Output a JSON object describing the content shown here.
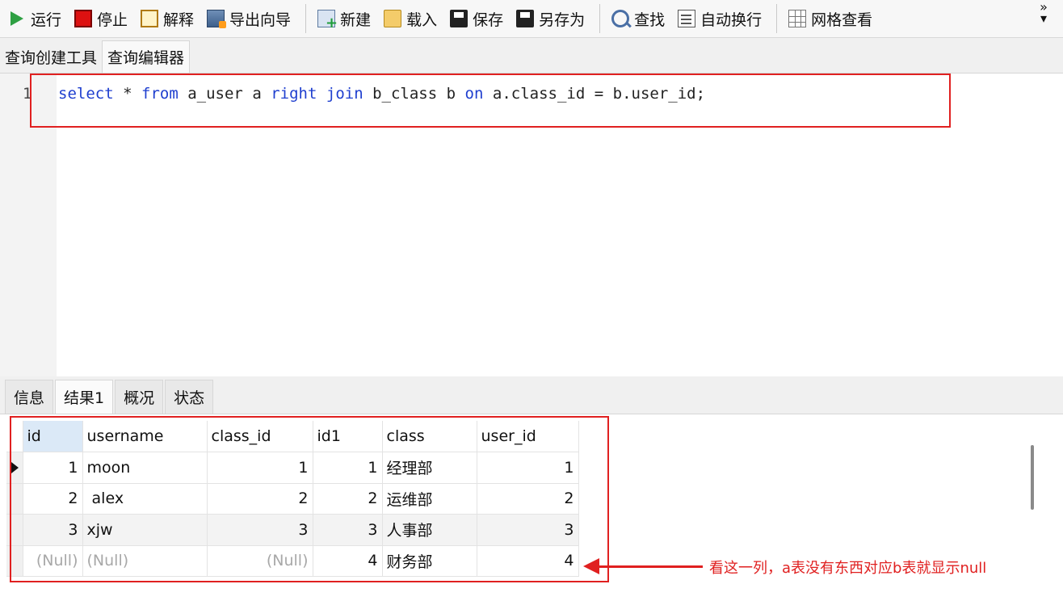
{
  "toolbar": {
    "buttons": [
      {
        "label": "运行",
        "icon": "run-icon"
      },
      {
        "label": "停止",
        "icon": "stop-icon"
      },
      {
        "label": "解释",
        "icon": "explain-icon"
      },
      {
        "label": "导出向导",
        "icon": "export-icon"
      },
      {
        "label": "新建",
        "icon": "new-icon"
      },
      {
        "label": "载入",
        "icon": "load-icon"
      },
      {
        "label": "保存",
        "icon": "save-icon"
      },
      {
        "label": "另存为",
        "icon": "save-as-icon"
      },
      {
        "label": "查找",
        "icon": "search-icon"
      },
      {
        "label": "自动换行",
        "icon": "word-wrap-icon"
      },
      {
        "label": "网格查看",
        "icon": "grid-view-icon"
      }
    ],
    "overflow": "»\n▾"
  },
  "editor_tabs": [
    "查询创建工具",
    "查询编辑器"
  ],
  "editor": {
    "line_number": "1",
    "sql": "select * from a_user a right join b_class b on a.class_id = b.user_id;"
  },
  "result_tabs": [
    "信息",
    "结果1",
    "概况",
    "状态"
  ],
  "grid": {
    "columns": [
      "id",
      "username",
      "class_id",
      "id1",
      "class",
      "user_id"
    ],
    "rows": [
      [
        "1",
        "moon",
        "1",
        "1",
        "经理部",
        "1"
      ],
      [
        "2",
        " alex",
        "2",
        "2",
        "运维部",
        "2"
      ],
      [
        "3",
        "xjw",
        "3",
        "3",
        "人事部",
        "3"
      ],
      [
        "(Null)",
        "(Null)",
        "(Null)",
        "4",
        "财务部",
        "4"
      ]
    ]
  },
  "annotation": "看这一列，a表没有东西对应b表就显示null",
  "colors": {
    "highlight": "#e02020",
    "keyword": "#1f3fcf"
  }
}
